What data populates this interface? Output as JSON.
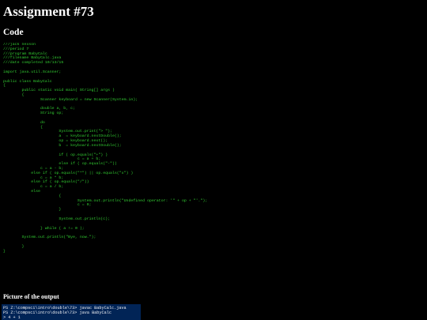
{
  "title": "Assignment #73",
  "code_heading": "Code",
  "code_lines": [
    "///jack nexson",
    "///period 7",
    "///program BabyCalc",
    "///filename BabyCalc.java",
    "///date completed 10/13/15",
    "",
    "import java.util.Scanner;",
    "",
    "public class BabyCalc",
    "{",
    "        public static void main( String[] args )",
    "        {",
    "                Scanner keyboard = new Scanner(System.in);",
    "",
    "                double a, b, c;",
    "                String op;",
    "",
    "                do",
    "                {",
    "                        System.out.print(\"> \");",
    "                        a  = keyboard.nextDouble();",
    "                        op = keyboard.next();",
    "                        b  = keyboard.nextDouble();",
    "",
    "                        if ( op.equals(\"+\") )",
    "                                c = a + b;",
    "                        else if ( op.equals(\"-\"))",
    "                c = a - b;",
    "            else if ( op.equals(\"*\") || op.equals(\"x\") )",
    "                c = a * b;",
    "            else if ( op.equals(\"/\"))",
    "                c = a / b;",
    "            else",
    "                        {",
    "                                System.out.println(\"Undefined operator: '\" + op + \"'.\");",
    "                                c = 0;",
    "                        }",
    "",
    "                        System.out.println(c);",
    "",
    "                } while ( a != 0 );",
    "",
    "        System.out.println(\"Bye, now.\");",
    "",
    "        }",
    "}"
  ],
  "output_heading": "Picture of the output",
  "terminal": {
    "lines": [
      "PS Z:\\compsci\\intro\\double\\73> javac BabyCalc.java",
      "PS Z:\\compsci\\intro\\double\\73> java BabyCalc",
      "> 4 + 1"
    ],
    "background": "#012456",
    "text_color": "#eeedf0"
  },
  "colors": {
    "page_background": "#000000",
    "heading_text": "#ffffff",
    "code_text": "#32cd32"
  }
}
